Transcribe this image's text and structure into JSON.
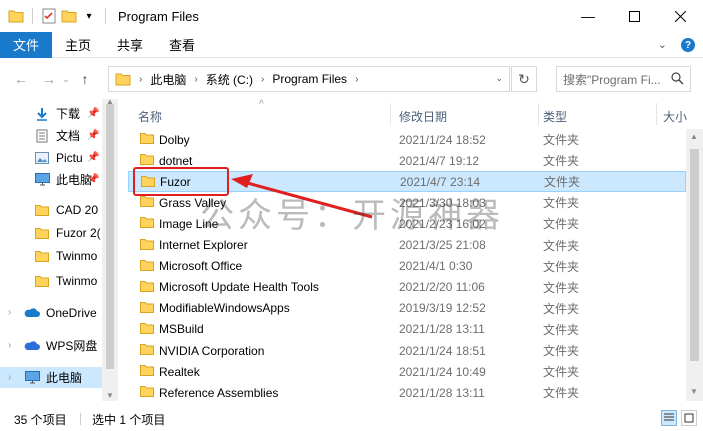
{
  "window": {
    "title": "Program Files"
  },
  "ribbon": {
    "tabs": [
      "文件",
      "主页",
      "共享",
      "查看"
    ]
  },
  "address": {
    "crumbs": [
      "此电脑",
      "系统 (C:)",
      "Program Files"
    ]
  },
  "search": {
    "placeholder": "搜索\"Program Fi..."
  },
  "nav": {
    "items": [
      {
        "label": "下载",
        "icon": "download-icon",
        "pinned": true
      },
      {
        "label": "文档",
        "icon": "document-icon",
        "pinned": true
      },
      {
        "label": "Pictu",
        "icon": "pictures-icon",
        "pinned": true
      },
      {
        "label": "此电脑",
        "icon": "computer-icon",
        "pinned": true
      },
      {
        "label": "CAD 20",
        "icon": "folder-icon",
        "pinned": false
      },
      {
        "label": "Fuzor 2(",
        "icon": "folder-icon",
        "pinned": false
      },
      {
        "label": "Twinmo",
        "icon": "folder-icon",
        "pinned": false
      },
      {
        "label": "Twinmo",
        "icon": "folder-icon",
        "pinned": false
      },
      {
        "label": "OneDrive",
        "icon": "onedrive-icon",
        "pinned": false
      },
      {
        "label": "WPS网盘",
        "icon": "wps-cloud-icon",
        "pinned": false
      },
      {
        "label": "此电脑",
        "icon": "computer-icon",
        "pinned": false
      }
    ]
  },
  "columns": {
    "name": "名称",
    "date": "修改日期",
    "type": "类型",
    "size": "大小"
  },
  "files": [
    {
      "name": "Dolby",
      "date": "2021/1/24 18:52",
      "type": "文件夹"
    },
    {
      "name": "dotnet",
      "date": "2021/4/7 19:12",
      "type": "文件夹"
    },
    {
      "name": "Fuzor",
      "date": "2021/4/7 23:14",
      "type": "文件夹"
    },
    {
      "name": "Grass Valley",
      "date": "2021/3/30 18:03",
      "type": "文件夹"
    },
    {
      "name": "Image Line",
      "date": "2021/2/23 16:02",
      "type": "文件夹"
    },
    {
      "name": "Internet Explorer",
      "date": "2021/3/25 21:08",
      "type": "文件夹"
    },
    {
      "name": "Microsoft Office",
      "date": "2021/4/1 0:30",
      "type": "文件夹"
    },
    {
      "name": "Microsoft Update Health Tools",
      "date": "2021/2/20 11:06",
      "type": "文件夹"
    },
    {
      "name": "ModifiableWindowsApps",
      "date": "2019/3/19 12:52",
      "type": "文件夹"
    },
    {
      "name": "MSBuild",
      "date": "2021/1/28 13:11",
      "type": "文件夹"
    },
    {
      "name": "NVIDIA Corporation",
      "date": "2021/1/24 18:51",
      "type": "文件夹"
    },
    {
      "name": "Realtek",
      "date": "2021/1/24 10:49",
      "type": "文件夹"
    },
    {
      "name": "Reference Assemblies",
      "date": "2021/1/28 13:11",
      "type": "文件夹"
    }
  ],
  "status": {
    "count": "35 个项目",
    "selected": "选中 1 个项目"
  },
  "overlay": {
    "watermark": "公众号：开源神器"
  },
  "colors": {
    "accent": "#1979ca",
    "selection": "#cce8ff",
    "annotation": "#e02020"
  }
}
